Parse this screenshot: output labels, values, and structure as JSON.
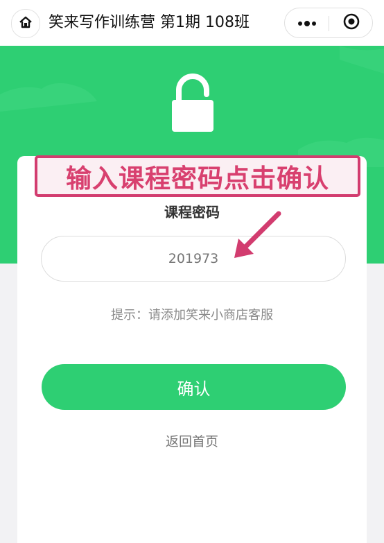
{
  "header": {
    "title": "笑来写作训练营 第1期 108班"
  },
  "banner": {
    "text": "输入课程密码点击确认"
  },
  "form": {
    "label": "课程密码",
    "password_value": "201973",
    "hint": "提示：请添加笑来小商店客服",
    "confirm_label": "确认",
    "back_label": "返回首页"
  },
  "icons": [
    "home-icon",
    "more-icon",
    "close-target-icon",
    "lock-icon",
    "arrow-icon"
  ],
  "colors": {
    "brand_green": "#2ecf73",
    "annotation_pink": "#d23c6f"
  }
}
